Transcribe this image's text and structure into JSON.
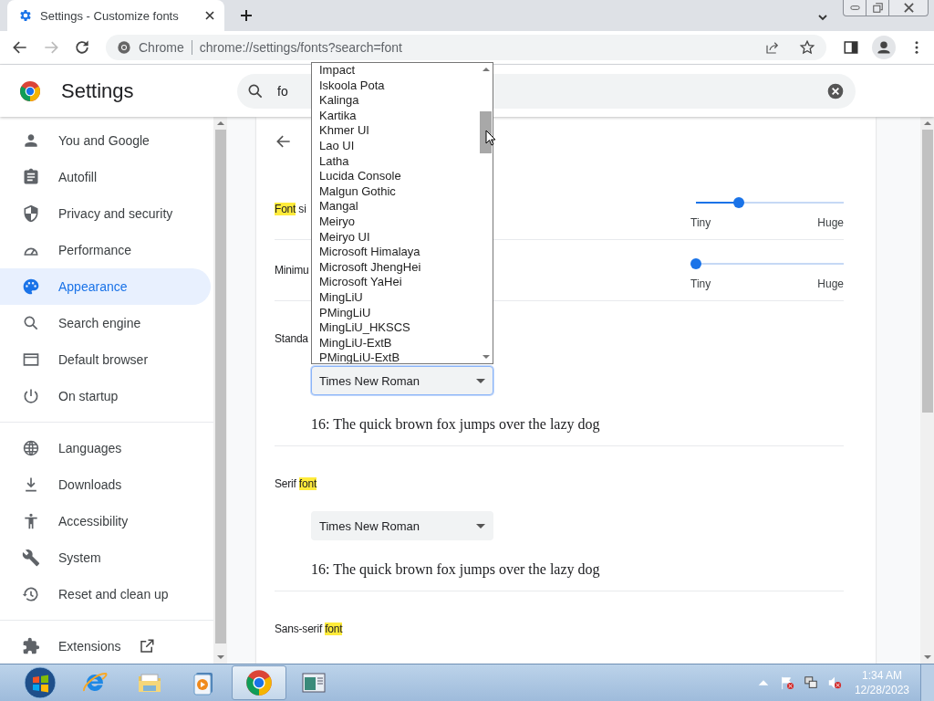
{
  "browser": {
    "tab": {
      "title": "Settings - Customize fonts",
      "selected": true
    },
    "omnibox": {
      "origin": "Chrome",
      "url": "chrome://settings/fonts?search=font"
    }
  },
  "header": {
    "title": "Settings",
    "search": {
      "value": "fo"
    }
  },
  "sidebar": {
    "groups": [
      {
        "items": [
          {
            "label": "You and Google",
            "selected": false
          },
          {
            "label": "Autofill",
            "selected": false
          },
          {
            "label": "Privacy and security",
            "selected": false
          },
          {
            "label": "Performance",
            "selected": false
          },
          {
            "label": "Appearance",
            "selected": true
          },
          {
            "label": "Search engine",
            "selected": false
          },
          {
            "label": "Default browser",
            "selected": false
          },
          {
            "label": "On startup",
            "selected": false
          }
        ]
      },
      {
        "items": [
          {
            "label": "Languages",
            "selected": false
          },
          {
            "label": "Downloads",
            "selected": false
          },
          {
            "label": "Accessibility",
            "selected": false
          },
          {
            "label": "System",
            "selected": false
          },
          {
            "label": "Reset and clean up",
            "selected": false
          }
        ]
      },
      {
        "items": [
          {
            "label": "Extensions",
            "selected": false
          }
        ]
      }
    ]
  },
  "page": {
    "rows": [
      {
        "kind": "slider",
        "label": [
          {
            "text": "Font",
            "highlight": true
          },
          {
            "text": " si",
            "highlight": false
          }
        ],
        "level": 0.29,
        "min_label": "Tiny",
        "max_label": "Huge"
      },
      {
        "kind": "slider",
        "label": [
          {
            "text": "Minimu",
            "highlight": false
          }
        ],
        "level": 0,
        "min_label": "Tiny",
        "max_label": "Huge"
      },
      {
        "kind": "font",
        "label": [
          {
            "text": "Standa",
            "highlight": false
          }
        ],
        "select": {
          "value": "Times New Roman",
          "open": true
        },
        "sample": "16: The quick brown fox jumps over the lazy dog"
      },
      {
        "kind": "font",
        "label": [
          {
            "text": "Serif ",
            "highlight": false
          },
          {
            "text": "font",
            "highlight": true
          }
        ],
        "select": {
          "value": "Times New Roman",
          "open": false
        },
        "sample": "16: The quick brown fox jumps over the lazy dog"
      },
      {
        "kind": "heading",
        "label": [
          {
            "text": "Sans-serif ",
            "highlight": false
          },
          {
            "text": "font",
            "highlight": true
          }
        ]
      }
    ]
  },
  "dropdown": {
    "options": [
      "Impact",
      "Iskoola Pota",
      "Kalinga",
      "Kartika",
      "Khmer UI",
      "Lao UI",
      "Latha",
      "Lucida Console",
      "Malgun Gothic",
      "Mangal",
      "Meiryo",
      "Meiryo UI",
      "Microsoft Himalaya",
      "Microsoft JhengHei",
      "Microsoft YaHei",
      "MingLiU",
      "PMingLiU",
      "MingLiU_HKSCS",
      "MingLiU-ExtB",
      "PMingLiU-ExtB"
    ]
  },
  "taskbar": {
    "apps": [
      {
        "selected": false
      },
      {
        "selected": false
      },
      {
        "selected": false
      },
      {
        "selected": true
      },
      {
        "selected": false
      }
    ],
    "clock": {
      "time": "1:34 AM",
      "date": "12/28/2023"
    }
  }
}
